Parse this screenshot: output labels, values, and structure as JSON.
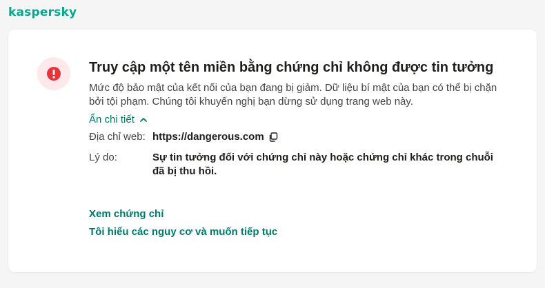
{
  "header": {
    "logo_text": "kaspersky"
  },
  "warning": {
    "icon": "error-alert-icon",
    "accent_color": "#e8333d",
    "title": "Truy cập một tên miền bằng chứng chỉ không được tin tưởng",
    "description": "Mức độ bảo mật của kết nối của bạn đang bị giảm. Dữ liệu bí mật của bạn có thể bị chặn bởi tội phạm. Chúng tôi khuyến nghị bạn dừng sử dụng trang web này.",
    "toggle_label": "Ẩn chi tiết",
    "toggle_icon": "chevron-up-icon"
  },
  "details": {
    "url_label": "Địa chỉ web:",
    "url_value": "https://dangerous.com",
    "copy_icon": "copy-icon",
    "reason_label": "Lý do:",
    "reason_value": "Sự tin tưởng đối với chứng chỉ này hoặc chứng chỉ khác trong chuỗi đã bị thu hồi."
  },
  "actions": {
    "view_certificate": "Xem chứng chỉ",
    "proceed": "Tôi hiểu các nguy cơ và muốn tiếp tục"
  },
  "colors": {
    "brand": "#00a88e",
    "link": "#00796b",
    "icon_bg": "#fde9ea"
  }
}
